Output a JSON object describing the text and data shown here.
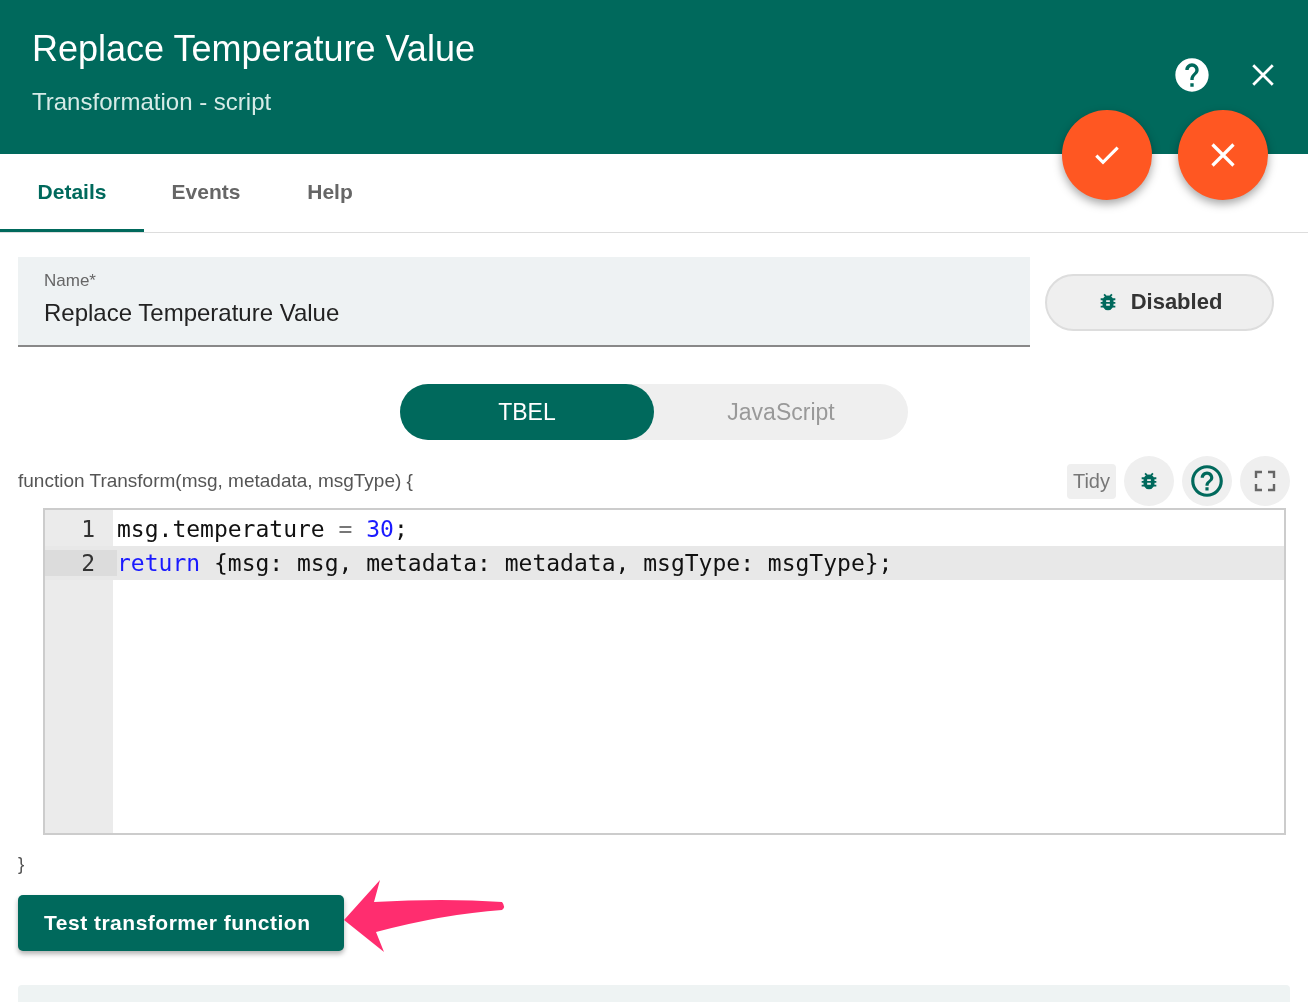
{
  "header": {
    "title": "Replace Temperature Value",
    "subtitle": "Transformation - script"
  },
  "tabs": [
    {
      "label": "Details",
      "selected": true
    },
    {
      "label": "Events",
      "selected": false
    },
    {
      "label": "Help",
      "selected": false
    }
  ],
  "name_field": {
    "label": "Name*",
    "value": "Replace Temperature Value"
  },
  "debug_button": {
    "label": "Disabled"
  },
  "languages": [
    {
      "label": "TBEL",
      "selected": true
    },
    {
      "label": "JavaScript",
      "selected": false
    }
  ],
  "function_signature": "function Transform(msg, metadata, msgType) {",
  "tidy_button": "Tidy",
  "code_lines": [
    {
      "number": "1",
      "active": false,
      "tokens": [
        {
          "kind": "plain",
          "text": "msg.temperature "
        },
        {
          "kind": "operator",
          "text": "= "
        },
        {
          "kind": "number",
          "text": "30"
        },
        {
          "kind": "plain",
          "text": ";"
        }
      ]
    },
    {
      "number": "2",
      "active": true,
      "tokens": [
        {
          "kind": "keyword",
          "text": "return"
        },
        {
          "kind": "plain",
          "text": " {msg: msg, metadata: metadata, msgType: msgType};"
        }
      ]
    }
  ],
  "function_end": "}",
  "test_button": "Test transformer function"
}
